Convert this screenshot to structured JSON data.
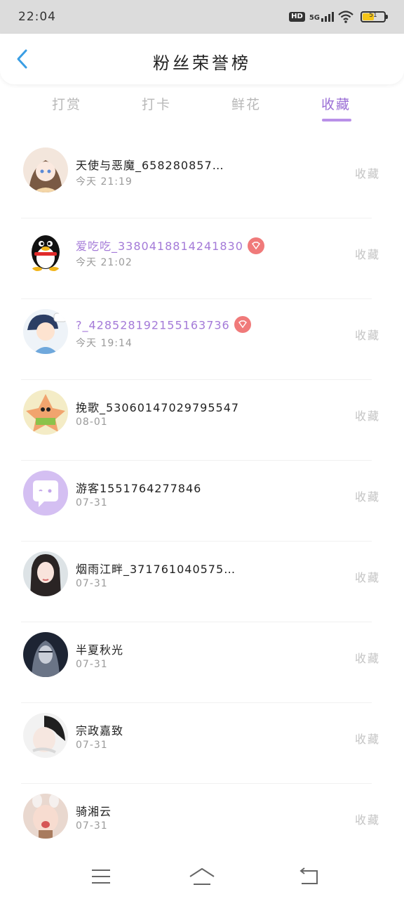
{
  "status_bar": {
    "time": "22:04",
    "hd": "HD",
    "network": "5G",
    "battery": "51",
    "battery_level": 0.51
  },
  "header": {
    "title": "粉丝荣誉榜"
  },
  "tabs": [
    {
      "label": "打赏"
    },
    {
      "label": "打卡"
    },
    {
      "label": "鲜花"
    },
    {
      "label": "收藏"
    }
  ],
  "active_tab": "收藏",
  "list": [
    {
      "name": "天使与恶魔_658280857…",
      "date": "今天 21:19",
      "action": "收藏",
      "vip": false
    },
    {
      "name": "爱吃吃_3380418814241830",
      "date": "今天 21:02",
      "action": "收藏",
      "vip": true
    },
    {
      "name": "?_428528192155163736",
      "date": "今天 19:14",
      "action": "收藏",
      "vip": true
    },
    {
      "name": "挽歌_53060147029795547",
      "date": "08-01",
      "action": "收藏",
      "vip": false
    },
    {
      "name": "游客1551764277846",
      "date": "07-31",
      "action": "收藏",
      "vip": false
    },
    {
      "name": "烟雨江畔_371761040575…",
      "date": "07-31",
      "action": "收藏",
      "vip": false
    },
    {
      "name": "半夏秋光",
      "date": "07-31",
      "action": "收藏",
      "vip": false
    },
    {
      "name": "宗政嘉致",
      "date": "07-31",
      "action": "收藏",
      "vip": false
    },
    {
      "name": "骑湘云",
      "date": "07-31",
      "action": "收藏",
      "vip": false
    }
  ],
  "colors": {
    "accent": "#9b6fd6",
    "vip_name": "#a47ad8",
    "vip_badge": "#f07a7a",
    "back_arrow": "#3a9ee4"
  }
}
